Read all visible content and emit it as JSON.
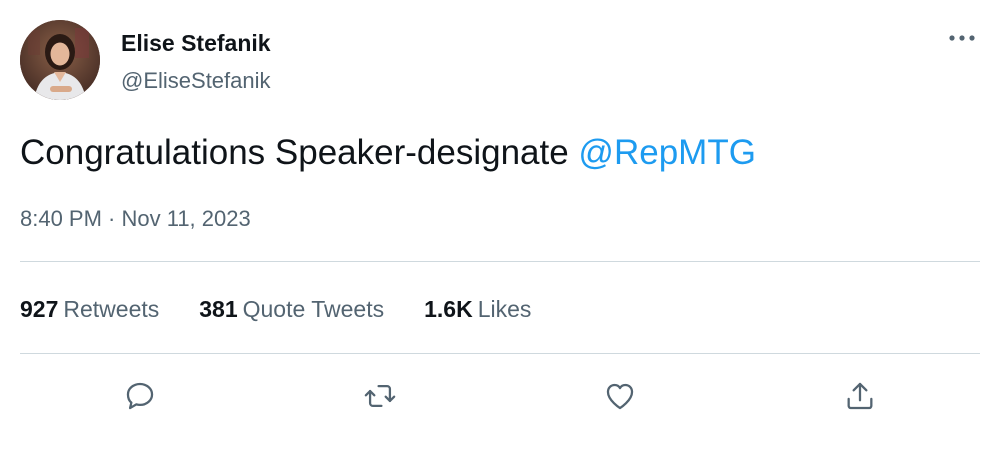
{
  "tweet": {
    "author": {
      "display_name": "Elise Stefanik",
      "handle": "@EliseStefanik",
      "avatar_icon": "profile-photo"
    },
    "more_icon": "more-dots-icon",
    "text": "Congratulations Speaker-designate ",
    "mention": "@RepMTG",
    "timestamp": "8:40 PM · Nov 11, 2023",
    "stats": {
      "retweets_count": "927",
      "retweets_label": "Retweets",
      "quotes_count": "381",
      "quotes_label": "Quote Tweets",
      "likes_count": "1.6K",
      "likes_label": "Likes"
    },
    "actions": [
      "reply-icon",
      "retweet-icon",
      "like-icon",
      "share-icon"
    ]
  },
  "colors": {
    "text_primary": "#0f1419",
    "text_secondary": "#536471",
    "link": "#1d9bf0",
    "divider": "#cfd9de"
  }
}
